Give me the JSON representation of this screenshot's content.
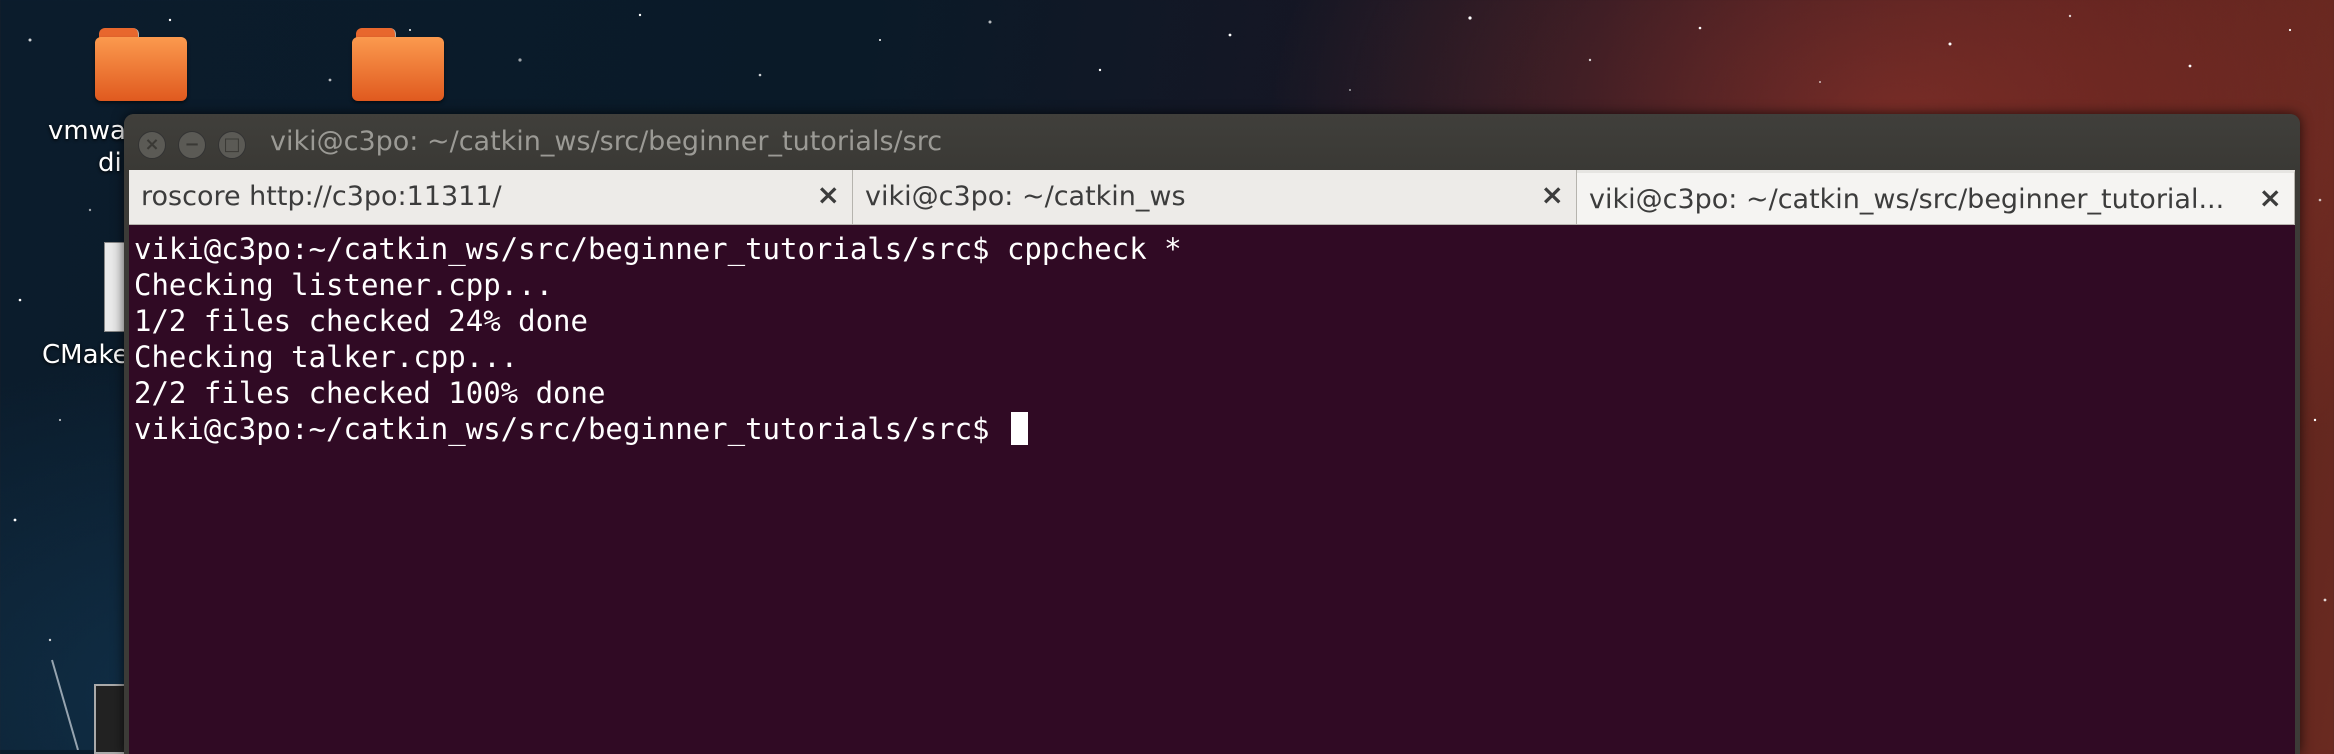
{
  "desktop": {
    "icons": [
      {
        "label_line1": "vmwa",
        "label_line2": "di",
        "icon": "folder-icon"
      },
      {
        "label_line1": "",
        "label_line2": "",
        "icon": "folder-icon"
      },
      {
        "label_line1": "CMake",
        "icon": "text-file-icon"
      }
    ]
  },
  "window": {
    "title": "viki@c3po: ~/catkin_ws/src/beginner_tutorials/src",
    "buttons": {
      "close": "×",
      "minimize": "−",
      "maximize": "□"
    }
  },
  "tabs": [
    {
      "label": "roscore http://c3po:11311/",
      "close": "×",
      "active": false
    },
    {
      "label": "viki@c3po: ~/catkin_ws",
      "close": "×",
      "active": false
    },
    {
      "label": "viki@c3po: ~/catkin_ws/src/beginner_tutorial...",
      "close": "×",
      "active": true
    }
  ],
  "terminal": {
    "lines": [
      "viki@c3po:~/catkin_ws/src/beginner_tutorials/src$ cppcheck *",
      "Checking listener.cpp...",
      "1/2 files checked 24% done",
      "Checking talker.cpp...",
      "2/2 files checked 100% done"
    ],
    "prompt": "viki@c3po:~/catkin_ws/src/beginner_tutorials/src$ "
  },
  "colors": {
    "terminal_bg": "#300a24",
    "terminal_fg": "#ffffff",
    "titlebar": "#3c3b37",
    "folder": "#f0732f"
  }
}
